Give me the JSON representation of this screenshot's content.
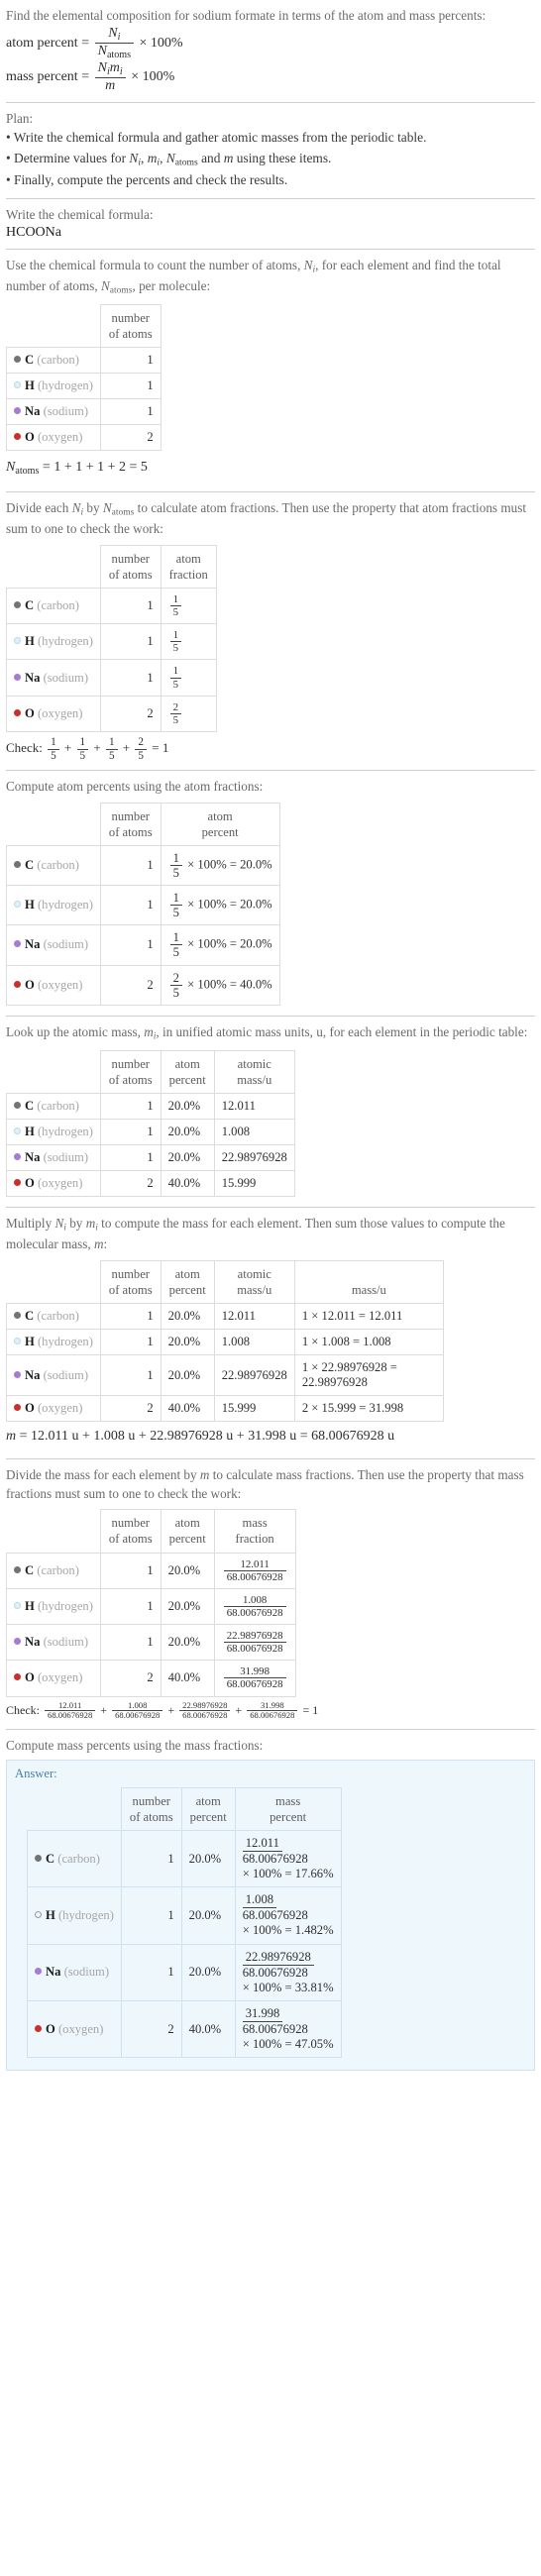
{
  "question": "Find the elemental composition for sodium formate in terms of the atom and mass percents:",
  "formula_defs": {
    "atom_percent_label": "atom percent",
    "mass_percent_label": "mass percent",
    "eq": "=",
    "times100": "× 100%",
    "Ni": "N",
    "i": "i",
    "Natoms_sub": "atoms",
    "N": "N",
    "m": "m"
  },
  "plan": {
    "title": "Plan:",
    "items": [
      "Write the chemical formula and gather atomic masses from the periodic table.",
      "Determine values for N<sub>i</sub>, m<sub>i</sub>, N<sub>atoms</sub> and m using these items.",
      "Finally, compute the percents and check the results."
    ],
    "item3_plain": "Finally, compute the percents and check the results.",
    "item1_plain": "Write the chemical formula and gather atomic masses from the periodic table."
  },
  "sections": {
    "write_formula_prompt": "Write the chemical formula:",
    "chemical_formula": "HCOONa",
    "count_atoms_prompt": "Use the chemical formula to count the number of atoms, N_i, for each element and find the total number of atoms, N_atoms, per molecule:",
    "natoms_equation": "N_atoms = 1 + 1 + 1 + 2 = 5",
    "natoms_rhs": "= 1 + 1 + 1 + 2 = 5",
    "atom_fraction_prompt": "Divide each N_i by N_atoms to calculate atom fractions. Then use the property that atom fractions must sum to one to check the work:",
    "atom_percent_prompt": "Compute atom percents using the atom fractions:",
    "atomic_mass_prompt": "Look up the atomic mass, m_i, in unified atomic mass units, u, for each element in the periodic table:",
    "molecular_mass_prompt": "Multiply N_i by m_i to compute the mass for each element. Then sum those values to compute the molecular mass, m:",
    "molecular_mass_equation": "m = 12.011 u + 1.008 u + 22.98976928 u + 31.998 u = 68.00676928 u",
    "mass_fraction_prompt": "Divide the mass for each element by m to calculate mass fractions. Then use the property that mass fractions must sum to one to check the work:",
    "mass_percent_prompt": "Compute mass percents using the mass fractions:",
    "answer_label": "Answer:"
  },
  "headers": {
    "number_of_atoms": [
      "number",
      "of atoms"
    ],
    "atom_fraction": [
      "atom",
      "fraction"
    ],
    "atom_percent": [
      "atom",
      "percent"
    ],
    "atomic_mass": [
      "atomic",
      "mass/u"
    ],
    "mass": [
      "",
      "mass/u"
    ],
    "mass_label": "mass/u",
    "mass_fraction": [
      "mass",
      "fraction"
    ],
    "mass_percent": [
      "mass",
      "percent"
    ]
  },
  "elements": [
    {
      "symbol": "C",
      "name": "(carbon)",
      "color": "#737373",
      "filled": true,
      "count": "1",
      "fraction_num": "1",
      "fraction_den": "5",
      "atom_percent": "20.0%",
      "atomic_mass": "12.011",
      "mass_expr": "1 × 12.011 = 12.011",
      "mass_frac_num": "12.011",
      "mass_frac_den": "68.00676928",
      "mass_percent": "17.66%"
    },
    {
      "symbol": "H",
      "name": "(hydrogen)",
      "color": "#ddf2fa",
      "filled": false,
      "count": "1",
      "fraction_num": "1",
      "fraction_den": "5",
      "atom_percent": "20.0%",
      "atomic_mass": "1.008",
      "mass_expr": "1 × 1.008 = 1.008",
      "mass_frac_num": "1.008",
      "mass_frac_den": "68.00676928",
      "mass_percent": "1.482%"
    },
    {
      "symbol": "Na",
      "name": "(sodium)",
      "color": "#a47cd4",
      "filled": true,
      "count": "1",
      "fraction_num": "1",
      "fraction_den": "5",
      "atom_percent": "20.0%",
      "atomic_mass": "22.98976928",
      "mass_expr": "1 × 22.98976928 = 22.98976928",
      "mass_frac_num": "22.98976928",
      "mass_frac_den": "68.00676928",
      "mass_percent": "33.81%"
    },
    {
      "symbol": "O",
      "name": "(oxygen)",
      "color": "#c9302c",
      "filled": true,
      "count": "2",
      "fraction_num": "2",
      "fraction_den": "5",
      "atom_percent": "40.0%",
      "atomic_mass": "15.999",
      "mass_expr": "2 × 15.999 = 31.998",
      "mass_frac_num": "31.998",
      "mass_frac_den": "68.00676928",
      "mass_percent": "47.05%"
    }
  ],
  "atom_percent_exprs": [
    {
      "num": "1",
      "den": "5",
      "rest": "× 100% = 20.0%"
    },
    {
      "num": "1",
      "den": "5",
      "rest": "× 100% = 20.0%"
    },
    {
      "num": "1",
      "den": "5",
      "rest": "× 100% = 20.0%"
    },
    {
      "num": "2",
      "den": "5",
      "rest": "× 100% = 40.0%"
    }
  ],
  "checks": {
    "atom_fraction_check_label": "Check:",
    "atom_fraction_terms": [
      {
        "num": "1",
        "den": "5"
      },
      {
        "num": "1",
        "den": "5"
      },
      {
        "num": "1",
        "den": "5"
      },
      {
        "num": "2",
        "den": "5"
      }
    ],
    "atom_fraction_result": "= 1",
    "mass_fraction_check_label": "Check:",
    "mass_fraction_terms": [
      {
        "num": "12.011",
        "den": "68.00676928"
      },
      {
        "num": "1.008",
        "den": "68.00676928"
      },
      {
        "num": "22.98976928",
        "den": "68.00676928"
      },
      {
        "num": "31.998",
        "den": "68.00676928"
      }
    ],
    "mass_fraction_result": "= 1",
    "plus": "+"
  },
  "molecular_mass": {
    "lhs": "m",
    "eq": "=",
    "rhs": "12.011 u + 1.008 u + 22.98976928 u + 31.998 u = 68.00676928 u"
  },
  "mass_percent_suffix": "× 100% =",
  "colors": {
    "answer_bg": "#eef7fc",
    "answer_border": "#cfe2ef",
    "answer_label": "#4a7fa8",
    "rule": "#cfcfcf",
    "table_border": "#dcdcdc"
  }
}
